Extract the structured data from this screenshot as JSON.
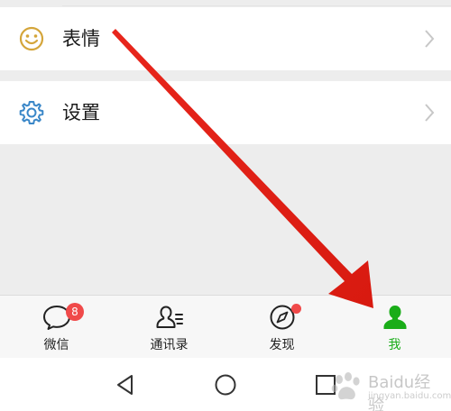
{
  "menu": {
    "items": [
      {
        "label": "表情",
        "icon": "smiley-icon"
      },
      {
        "label": "设置",
        "icon": "gear-icon"
      }
    ]
  },
  "tabbar": {
    "tabs": [
      {
        "label": "微信",
        "icon": "chat-bubble-icon",
        "badge": "8"
      },
      {
        "label": "通讯录",
        "icon": "contacts-icon"
      },
      {
        "label": "发现",
        "icon": "compass-icon",
        "dot": true
      },
      {
        "label": "我",
        "icon": "person-icon",
        "active": true
      }
    ]
  },
  "navbar": {
    "buttons": [
      "back-icon",
      "home-icon",
      "recents-icon"
    ]
  },
  "annotation": {
    "type": "red-arrow",
    "target": "tab-me",
    "color": "#e8261c"
  },
  "watermark": {
    "title": "Baidu经验",
    "subtitle": "jingyan.baidu.com"
  },
  "colors": {
    "accent": "#1aad19",
    "badge": "#f04a4a",
    "icon_emoji": "#d4a53a",
    "icon_settings": "#3a87c8",
    "arrow": "#e8261c"
  }
}
